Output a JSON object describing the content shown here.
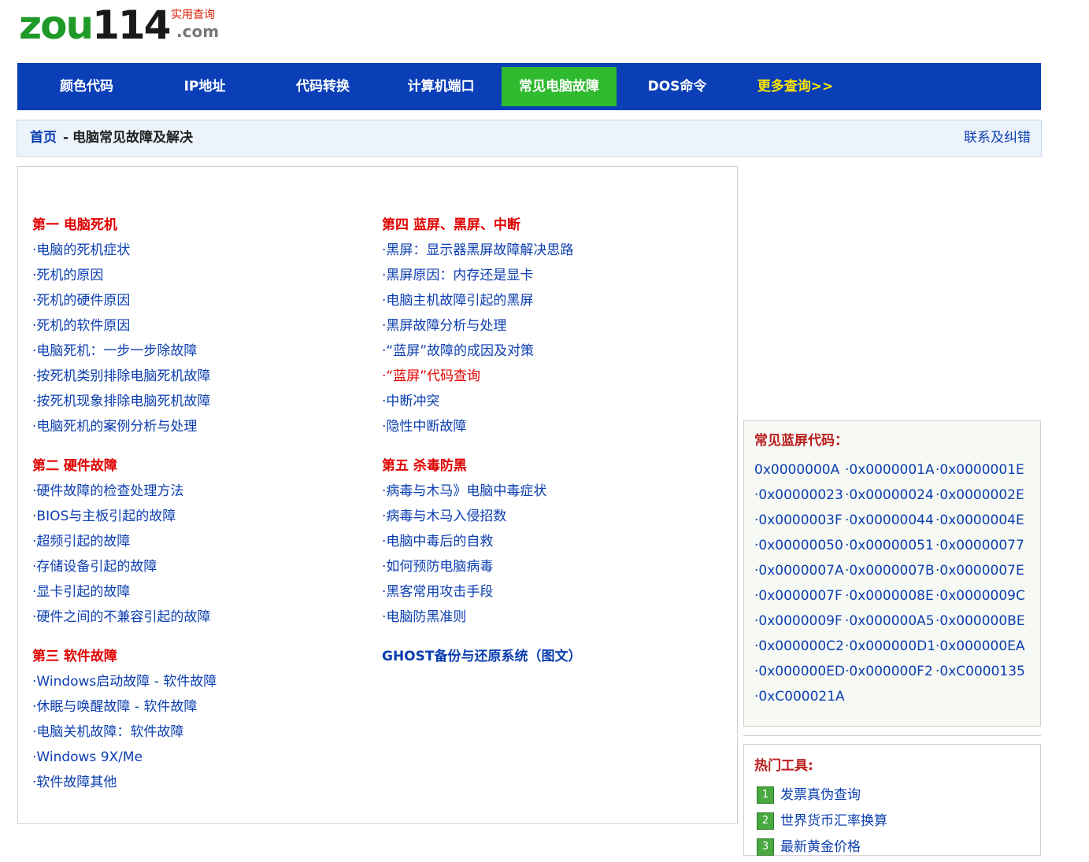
{
  "logo": {
    "part1": "zou",
    "part2": "114",
    "sub": "实用查询",
    "domain": ".com"
  },
  "nav": [
    {
      "label": "颜色代码"
    },
    {
      "label": "IP地址"
    },
    {
      "label": "代码转换"
    },
    {
      "label": "计算机端口"
    },
    {
      "label": "常见电脑故障",
      "active": true
    },
    {
      "label": "DOS命令"
    },
    {
      "label": "更多查询>>"
    }
  ],
  "breadcrumb": {
    "home": "首页",
    "separator": "-",
    "current": "电脑常见故障及解决",
    "contact": "联系及纠错"
  },
  "left_column": [
    {
      "title": "第一 电脑死机",
      "items": [
        "·电脑的死机症状",
        "·死机的原因",
        "·死机的硬件原因",
        "·死机的软件原因",
        "·电脑死机：一步一步除故障",
        "·按死机类别排除电脑死机故障",
        "·按死机现象排除电脑死机故障",
        "·电脑死机的案例分析与处理"
      ]
    },
    {
      "title": "第二 硬件故障",
      "items": [
        "·硬件故障的检查处理方法",
        "·BIOS与主板引起的故障",
        "·超频引起的故障",
        "·存储设备引起的故障",
        "·显卡引起的故障",
        "·硬件之间的不兼容引起的故障"
      ]
    },
    {
      "title": "第三 软件故障",
      "items": [
        "·Windows启动故障 - 软件故障",
        "·休眠与唤醒故障 - 软件故障",
        "·电脑关机故障：软件故障",
        "·Windows 9X/Me",
        "·软件故障其他"
      ]
    }
  ],
  "right_column": [
    {
      "title": "第四 蓝屏、黑屏、中断",
      "items": [
        "·黑屏：显示器黑屏故障解决思路",
        "·黑屏原因：内存还是显卡",
        "·电脑主机故障引起的黑屏",
        "·黑屏故障分析与处理",
        "·“蓝屏”故障的成因及对策",
        "·“蓝屏”代码查询",
        "·中断冲突",
        "·隐性中断故障"
      ]
    },
    {
      "title": "第五 杀毒防黑",
      "items": [
        "·病毒与木马》电脑中毒症状",
        "·病毒与木马入侵招数",
        "·电脑中毒后的自救",
        "·如何预防电脑病毒",
        "·黑客常用攻击手段",
        "·电脑防黑准则"
      ]
    },
    {
      "title": "GHOST备份与还原系统（图文）",
      "items": []
    }
  ],
  "bluescreen": {
    "title": "常见蓝屏代码：",
    "codes": [
      "0x0000000A",
      "·0x0000001A",
      "·0x0000001E",
      "·0x00000023",
      "·0x00000024",
      "·0x0000002E",
      "·0x0000003F",
      "·0x00000044",
      "·0x0000004E",
      "·0x00000050",
      "·0x00000051",
      "·0x00000077",
      "·0x0000007A",
      "·0x0000007B",
      "·0x0000007E",
      "·0x0000007F",
      "·0x0000008E",
      "·0x0000009C",
      "·0x0000009F",
      "·0x000000A5",
      "·0x000000BE",
      "·0x000000C2",
      "·0x000000D1",
      "·0x000000EA",
      "·0x000000ED",
      "·0x000000F2",
      "·0xC0000135",
      "·0xC000021A"
    ]
  },
  "hot_tools": {
    "title": "热门工具:",
    "items": [
      {
        "num": "1",
        "label": "发票真伪查询"
      },
      {
        "num": "2",
        "label": "世界货币汇率换算"
      },
      {
        "num": "3",
        "label": "最新黄金价格"
      }
    ]
  },
  "colors": {
    "nav_bg": "#0a3fb8",
    "nav_active": "#2fba2f",
    "nav_more": "#ffe600",
    "link": "#0b3eb0",
    "section_red": "#e00000"
  }
}
